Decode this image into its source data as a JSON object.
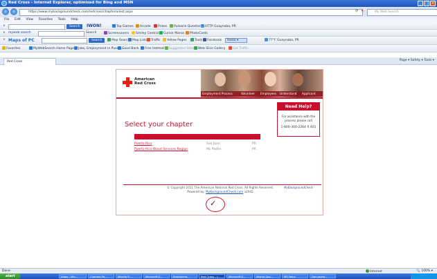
{
  "window": {
    "title": "Red Cross - Internet Explorer, optimized for Bing and MSN"
  },
  "address": {
    "url": "https://www.mybackgroundcheck.com/redcross/chapterselect.aspx",
    "search_placeholder": "My Web Search"
  },
  "menu": [
    "File",
    "Edit",
    "View",
    "Favorites",
    "Tools",
    "Help"
  ],
  "toolbar1": {
    "search_btn": "Search",
    "brand": "IWON!",
    "items": [
      "Top Games",
      "Arcade",
      "Prizes",
      "Pulsacle Question",
      "ΗΤΤP Guaynabo, PR"
    ]
  },
  "toolbar2": {
    "prefix": "myweb search",
    "items": [
      "Search",
      "Screensavers",
      "Smiley Central",
      "Cursor Mania",
      "PhotoCards"
    ]
  },
  "toolbar3": {
    "brand": "Maps of PC",
    "search_btn": "Search",
    "items": [
      "Map Search",
      "Map Lists",
      "Traffic",
      "Yellow Pages",
      "Tools",
      "Facebook",
      "Radio",
      "77°F Guaynabo, PR"
    ]
  },
  "favbar": {
    "label": "Favorites",
    "items": [
      "MyWebSearch Home Page",
      "Jobs, Employment in Puerto...",
      "Good Bank",
      "Free Hotmail",
      "Suggested Sites",
      "Web Slice Gallery",
      "Get Traffic"
    ]
  },
  "tab": {
    "label": "Red Cross",
    "tools": "Page ▾  Safety ▾  Tools ▾"
  },
  "page": {
    "brand_line1": "American",
    "brand_line2": "Red Cross",
    "banner_links": [
      "Employment Process",
      "Volunteer",
      "Employees",
      "Understand",
      "Applicant"
    ],
    "help_title": "Need Help?",
    "help_text": "For assistance with the process please call",
    "help_phone": "1-800-300-2264 X 401",
    "title": "Select your chapter",
    "chapters": [
      {
        "name": "Puerto Rico",
        "city": "San Juan",
        "state": "PR"
      },
      {
        "name": "Puerto Rico Blood Services Region",
        "city": "Mc Pastie",
        "state": "PR"
      }
    ],
    "copyright": "© Copyright 2011 The American National Red Cross. All Rights Reserved.",
    "powered_by": "Powered by:",
    "powered_link": "MyBackgroundCheck.com",
    "version": "v2042",
    "partner_logo": "MyBackgroundCheck",
    "seal_text": "Verified Security"
  },
  "status": {
    "left": "Done",
    "zone": "Internet",
    "zoom": "100%"
  },
  "taskbar": {
    "start": "start",
    "tasks": [
      "Inbox - Mic...",
      "Cuentas Pa...",
      "Mozilla Fi...",
      "Microsoft E...",
      "Employme...",
      "Red Cross - I...",
      "Microsoft E...",
      "Nuevo Doc...",
      "MS Paint",
      "Document..."
    ]
  }
}
